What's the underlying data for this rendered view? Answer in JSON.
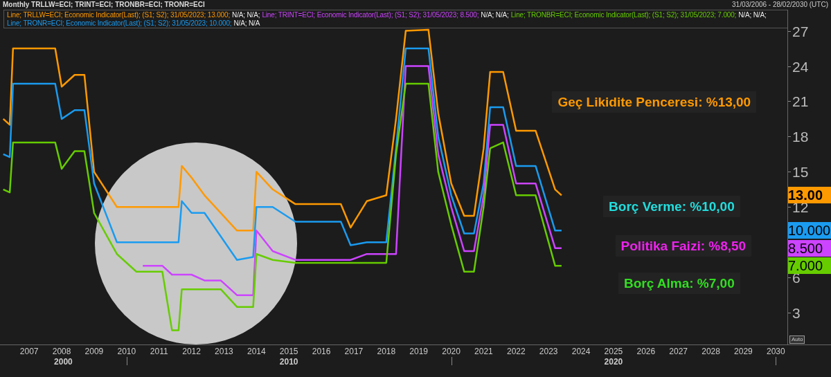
{
  "header": {
    "title": "Monthly TRLLW=ECI; TRINT=ECI; TRONBR=ECI; TRONR=ECI",
    "date_range": "31/03/2006 - 28/02/2030 (UTC)"
  },
  "legend": {
    "rows": [
      [
        {
          "text": "Line; TRLLW=ECI; Economic Indicator(Last); (S1; S2); 31/05/2023; 13.000;",
          "color": "#ff9900",
          "suffix": "N/A; N/A;"
        },
        {
          "text": "Line; TRINT=ECI; Economic Indicator(Last); (S1; S2); 31/05/2023; 8.500;",
          "color": "#cc44ff",
          "suffix": "N/A; N/A;"
        },
        {
          "text": "Line; TRONBR=ECI; Economic Indicator(Last); (S1; S2); 31/05/2023; 7.000;",
          "color": "#66cc00",
          "suffix": "N/A; N/A;"
        }
      ],
      [
        {
          "text": "Line; TRONR=ECI; Economic Indicator(Last); (S1; S2); 31/05/2023; 10.000;",
          "color": "#1a9bf0",
          "suffix": "N/A; N/A"
        }
      ]
    ]
  },
  "chart": {
    "chart_data": {
      "type": "line",
      "xlim": [
        2006.1,
        2031.7
      ],
      "ylim": [
        0.3,
        28.8
      ],
      "xticks": [
        {
          "value": 2007,
          "label": "2007"
        },
        {
          "value": 2008,
          "label": "2008"
        },
        {
          "value": 2009,
          "label": "2009"
        },
        {
          "value": 2010,
          "label": "2010"
        },
        {
          "value": 2011,
          "label": "2011"
        },
        {
          "value": 2012,
          "label": "2012"
        },
        {
          "value": 2013,
          "label": "2013"
        },
        {
          "value": 2014,
          "label": "2014"
        },
        {
          "value": 2015,
          "label": "2015"
        },
        {
          "value": 2016,
          "label": "2016"
        },
        {
          "value": 2017,
          "label": "2017"
        },
        {
          "value": 2018,
          "label": "2018"
        },
        {
          "value": 2019,
          "label": "2019"
        },
        {
          "value": 2020,
          "label": "2020"
        },
        {
          "value": 2021,
          "label": "2021"
        },
        {
          "value": 2022,
          "label": "2022"
        },
        {
          "value": 2023,
          "label": "2023"
        },
        {
          "value": 2024,
          "label": "2024"
        },
        {
          "value": 2025,
          "label": "2025"
        },
        {
          "value": 2026,
          "label": "2026"
        },
        {
          "value": 2027,
          "label": "2027"
        },
        {
          "value": 2028,
          "label": "2028"
        },
        {
          "value": 2029,
          "label": "2029"
        },
        {
          "value": 2030,
          "label": "2030"
        }
      ],
      "yticks": [
        {
          "value": 3,
          "label": "3"
        },
        {
          "value": 6,
          "label": "6"
        },
        {
          "value": 12,
          "label": "12"
        },
        {
          "value": 15,
          "label": "15"
        },
        {
          "value": 18,
          "label": "18"
        },
        {
          "value": 21,
          "label": "21"
        },
        {
          "value": 24,
          "label": "24"
        },
        {
          "value": 27,
          "label": "27"
        }
      ],
      "x": [
        2006.2,
        2006.4,
        2006.5,
        2007.8,
        2008.0,
        2008.4,
        2008.7,
        2009.0,
        2009.7,
        2010.3,
        2010.5,
        2011.1,
        2011.4,
        2011.6,
        2011.7,
        2012.0,
        2012.4,
        2012.9,
        2013.4,
        2013.9,
        2014.0,
        2014.5,
        2015.2,
        2016.6,
        2016.9,
        2017.4,
        2018.0,
        2018.3,
        2018.6,
        2019.3,
        2019.6,
        2020.0,
        2020.4,
        2020.7,
        2021.0,
        2021.2,
        2021.6,
        2022.0,
        2022.6,
        2023.2,
        2023.4
      ],
      "series": [
        {
          "color": "#ff9900",
          "values": [
            19.5,
            19,
            25.5,
            25.5,
            22.25,
            23.25,
            23.25,
            15,
            12,
            12,
            12,
            12,
            12,
            12,
            15.5,
            14.5,
            13,
            11.5,
            10,
            10,
            15,
            13.5,
            12.25,
            12.25,
            10.25,
            12.5,
            13,
            19.5,
            27,
            27.1,
            20,
            14,
            11.25,
            11.25,
            17,
            23.5,
            23.5,
            18.5,
            18.5,
            13.5,
            13
          ]
        },
        {
          "color": "#1a9bf0",
          "values": [
            16.5,
            16.25,
            22.5,
            22.5,
            19.5,
            20.25,
            20.25,
            14,
            9,
            9,
            9,
            9,
            9,
            9,
            12.5,
            11.5,
            11.5,
            9.5,
            7.5,
            7.75,
            12,
            12,
            10.75,
            10.75,
            8.75,
            9,
            9,
            17,
            25.5,
            25.5,
            18,
            13,
            9.75,
            9.75,
            14,
            20.5,
            20.5,
            15.5,
            15.5,
            10,
            10
          ]
        },
        {
          "color": "#cc44ff",
          "values": [
            null,
            null,
            null,
            null,
            null,
            null,
            null,
            null,
            null,
            null,
            7,
            7,
            6.25,
            6.25,
            6.25,
            6.25,
            5.75,
            5.75,
            4.5,
            4.5,
            10,
            8.25,
            7.5,
            7.5,
            7.5,
            8,
            8,
            8,
            24,
            24,
            16.5,
            12,
            8.25,
            8.25,
            13,
            19,
            19,
            14,
            14,
            8.5,
            8.5
          ]
        },
        {
          "color": "#66cc00",
          "values": [
            13.5,
            13.25,
            17.5,
            17.5,
            15.25,
            16.75,
            16.75,
            11.5,
            8,
            6.5,
            6.5,
            6.5,
            1.5,
            1.5,
            5,
            5,
            5,
            5,
            3.5,
            3.5,
            8,
            7.5,
            7.25,
            7.25,
            7.25,
            7.25,
            7.25,
            16.5,
            22.5,
            22.5,
            15,
            10.5,
            6.5,
            6.5,
            12,
            17,
            17.5,
            13,
            13,
            7,
            7
          ]
        }
      ]
    },
    "labels": [
      {
        "text": "Geç Likidite Penceresi: %13,00",
        "color": "#ff9900"
      },
      {
        "text": "Borç Verme: %10,00",
        "color": "#22dddd"
      },
      {
        "text": "Politika Faizi: %8,50",
        "color": "#ee22ee"
      },
      {
        "text": "Borç Alma: %7,00",
        "color": "#33dd22"
      }
    ],
    "value_tags": [
      {
        "text": "13.00",
        "color": "#ff9900"
      },
      {
        "text": "10.000",
        "color": "#1a9bf0"
      },
      {
        "text": "8.500",
        "color": "#cc44ff"
      },
      {
        "text": "7.000",
        "color": "#66cc00"
      }
    ],
    "decades": [
      "2000",
      "2010",
      "2020"
    ],
    "auto_button": "Auto"
  }
}
